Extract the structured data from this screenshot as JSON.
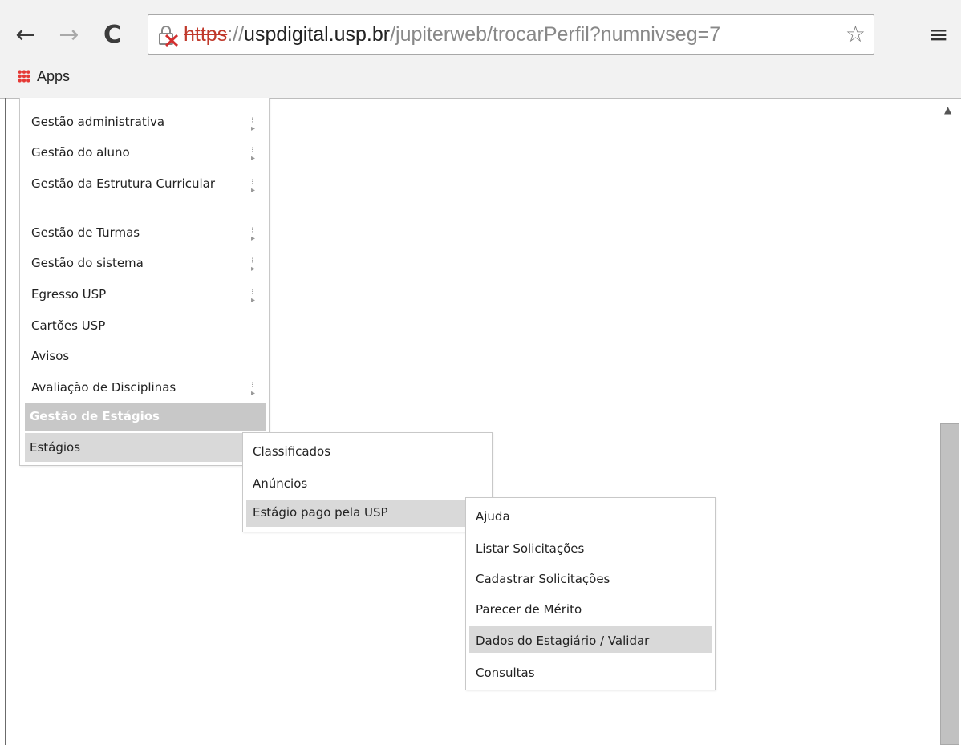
{
  "browser": {
    "url_scheme": "https",
    "url_separator": "://",
    "url_host": "uspdigital.usp.br",
    "url_path": "/jupiterweb/trocarPerfil?numnivseg=7",
    "bookmark_apps": "Apps"
  },
  "main_menu": {
    "items": [
      {
        "label": "Gestão administrativa",
        "has_submenu": true
      },
      {
        "label": "Gestão do aluno",
        "has_submenu": true
      },
      {
        "label": "Gestão da Estrutura Curricular",
        "has_submenu": true
      },
      {
        "label": "Gestão de Turmas",
        "has_submenu": true
      },
      {
        "label": "Gestão do sistema",
        "has_submenu": true
      },
      {
        "label": "Egresso USP",
        "has_submenu": true
      },
      {
        "label": "Cartões USP",
        "has_submenu": false
      },
      {
        "label": "Avisos",
        "has_submenu": false
      },
      {
        "label": "Avaliação de Disciplinas",
        "has_submenu": true
      }
    ],
    "section_header": "Gestão de Estágios",
    "active_item": "Estágios"
  },
  "submenu_estagios": {
    "items": [
      "Classificados",
      "Anúncios",
      "Estágio pago pela USP"
    ]
  },
  "submenu_estagio_pago": {
    "items": [
      "Ajuda",
      "Listar Solicitações",
      "Cadastrar Solicitações",
      "Parecer de Mérito",
      "Dados do Estagiário / Validar",
      "Consultas"
    ]
  }
}
